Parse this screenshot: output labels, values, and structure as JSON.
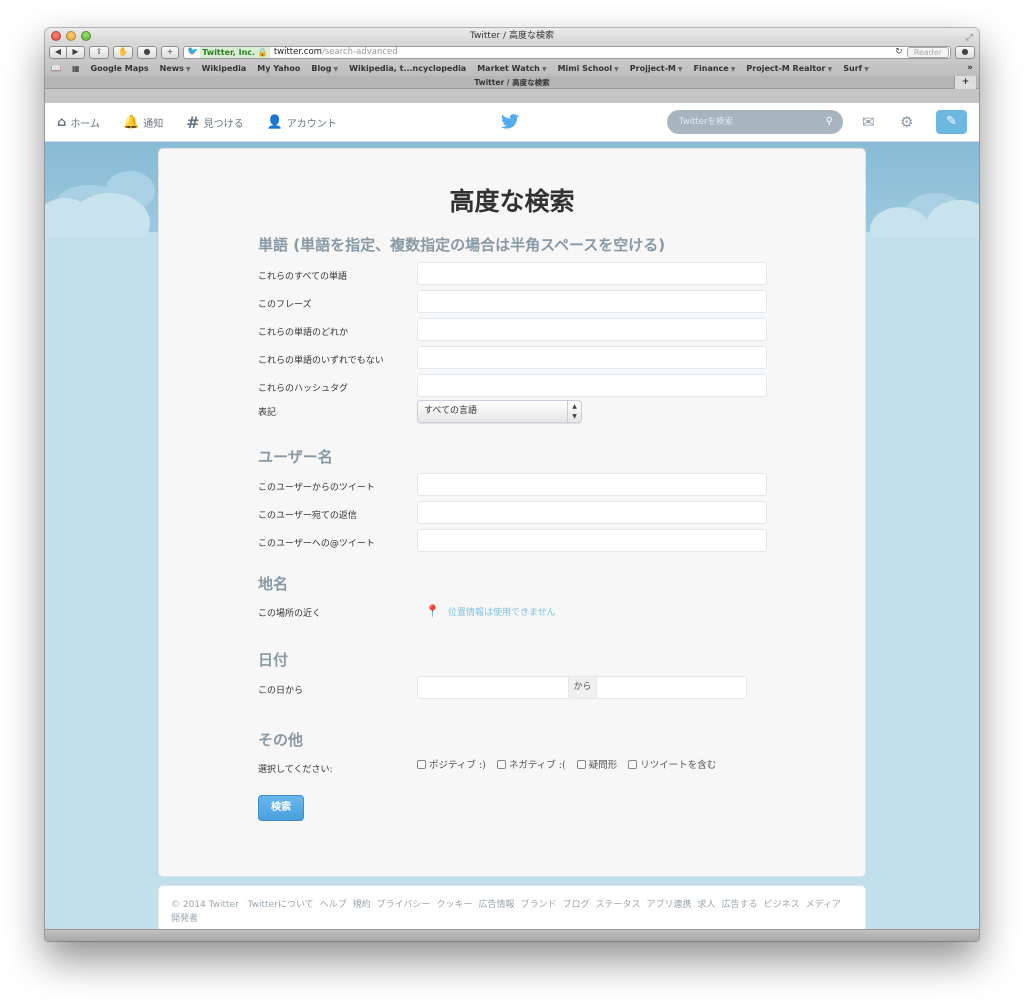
{
  "browser": {
    "window_title": "Twitter / 高度な検索",
    "address": {
      "cert_label": "Twitter, Inc.",
      "host": "twitter.com",
      "path": "/search-advanced"
    },
    "reader_label": "Reader",
    "bookmarks": [
      {
        "label": "Google Maps",
        "menu": false
      },
      {
        "label": "News",
        "menu": true
      },
      {
        "label": "Wikipedia",
        "menu": false
      },
      {
        "label": "My Yahoo",
        "menu": false
      },
      {
        "label": "Blog",
        "menu": true
      },
      {
        "label": "Wikipedia, t...ncyclopedia",
        "menu": false
      },
      {
        "label": "Market Watch",
        "menu": true
      },
      {
        "label": "Mimi School",
        "menu": true
      },
      {
        "label": "Projject-M",
        "menu": true
      },
      {
        "label": "Finance",
        "menu": true
      },
      {
        "label": "Project-M Realtor",
        "menu": true
      },
      {
        "label": "Surf",
        "menu": true
      }
    ],
    "tab_title": "Twitter / 高度な検索"
  },
  "twitter_nav": {
    "items": [
      {
        "label": "ホーム",
        "icon": "home-icon"
      },
      {
        "label": "通知",
        "icon": "bell-icon"
      },
      {
        "label": "見つける",
        "icon": "hashtag-icon"
      },
      {
        "label": "アカウント",
        "icon": "person-icon"
      }
    ],
    "search_placeholder": "Twitterを検索"
  },
  "page": {
    "title": "高度な検索",
    "sections": {
      "words": {
        "heading": "単語 (単語を指定、複数指定の場合は半角スペースを空ける)",
        "rows": [
          {
            "label": "これらのすべての単語",
            "value": ""
          },
          {
            "label": "このフレーズ",
            "value": ""
          },
          {
            "label": "これらの単語のどれか",
            "value": ""
          },
          {
            "label": "これらの単語のいずれでもない",
            "value": ""
          },
          {
            "label": "これらのハッシュタグ",
            "value": ""
          }
        ],
        "language_label": "表記",
        "language_selected": "すべての言語"
      },
      "users": {
        "heading": "ユーザー名",
        "rows": [
          {
            "label": "このユーザーからのツイート",
            "value": ""
          },
          {
            "label": "このユーザー宛ての返信",
            "value": ""
          },
          {
            "label": "このユーザーへの@ツイート",
            "value": ""
          }
        ]
      },
      "places": {
        "heading": "地名",
        "label": "この場所の近く",
        "geo_text": "位置情報は使用できません"
      },
      "dates": {
        "heading": "日付",
        "label": "この日から",
        "separator": "から",
        "from_value": "",
        "to_value": ""
      },
      "other": {
        "heading": "その他",
        "label": "選択してください:",
        "options": [
          {
            "label": "ポジティブ :)",
            "checked": false
          },
          {
            "label": "ネガティブ :(",
            "checked": false
          },
          {
            "label": "疑問形",
            "checked": false
          },
          {
            "label": "リツイートを含む",
            "checked": false
          }
        ]
      }
    },
    "submit_label": "検索"
  },
  "footer": {
    "copyright": "© 2014 Twitter",
    "links": [
      "Twitterについて",
      "ヘルプ",
      "規約",
      "プライバシー",
      "クッキー",
      "広告情報",
      "ブランド",
      "ブログ",
      "ステータス",
      "アプリ連携",
      "求人",
      "広告する",
      "ビジネス",
      "メディア",
      "開発者"
    ]
  },
  "colors": {
    "twitter_blue": "#55acee",
    "section_heading": "#8899a6",
    "sky": "#88bbd5"
  }
}
